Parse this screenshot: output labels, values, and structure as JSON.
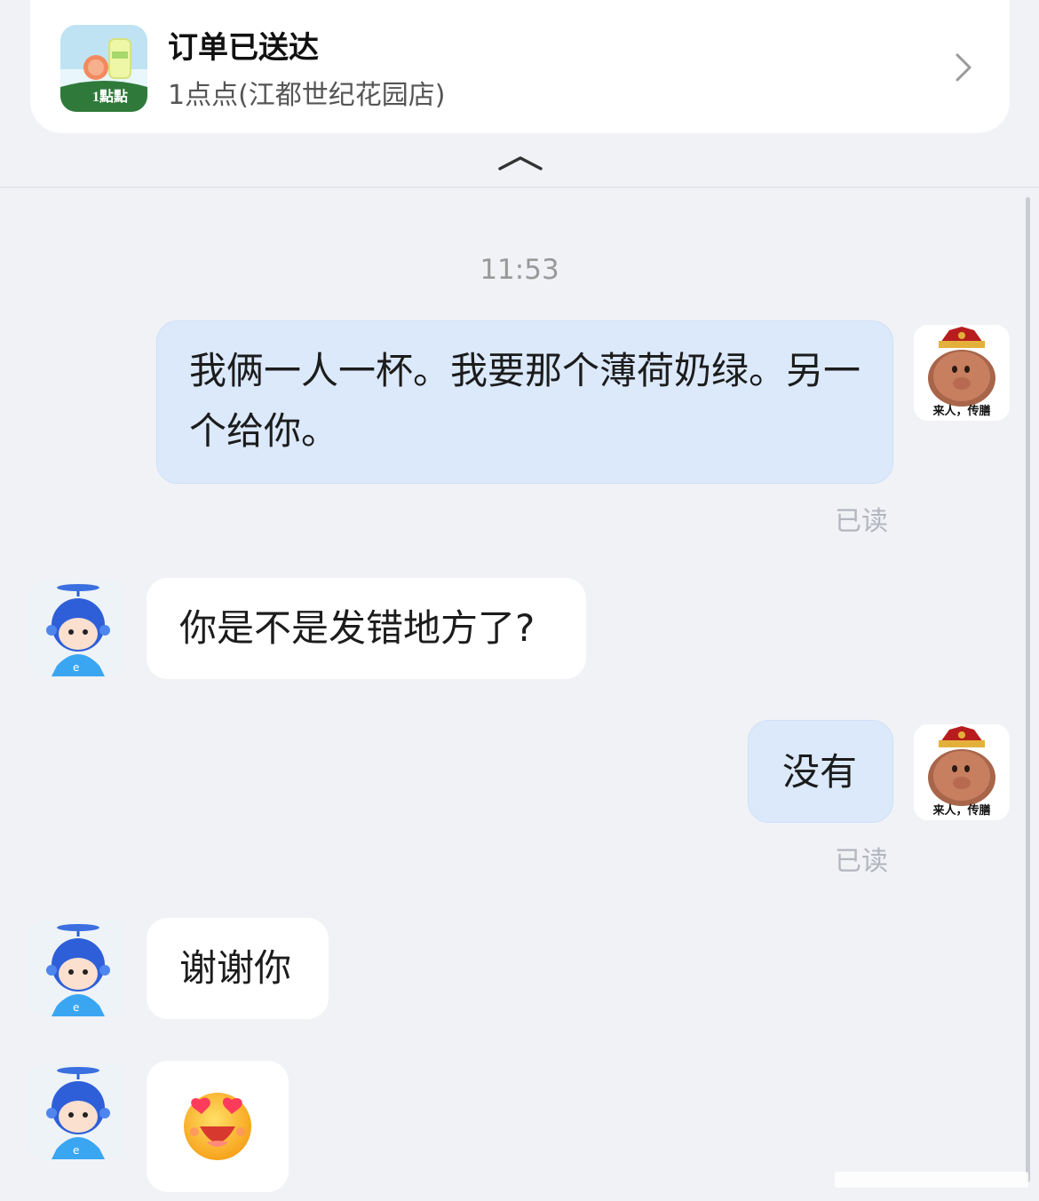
{
  "order": {
    "status": "订单已送达",
    "store": "1点点(江都世纪花园店)",
    "logo_mark": "1點點",
    "chevron_icon": "chevron-right-icon"
  },
  "collapse_icon": "chevron-up-icon",
  "timestamp": "11:53",
  "messages": [
    {
      "side": "me",
      "text": "我俩一人一杯。我要那个薄荷奶绿。另一个给你。",
      "read": "已读"
    },
    {
      "side": "them",
      "text": "你是不是发错地方了?"
    },
    {
      "side": "me",
      "text": "没有",
      "read": "已读"
    },
    {
      "side": "them",
      "text": "谢谢你"
    },
    {
      "side": "them",
      "emoji": "heart-eyes-emoji"
    }
  ],
  "my_avatar_caption": "来人，传膳",
  "colors": {
    "background": "#f0f2f6",
    "my_bubble": "#dbe9fb",
    "their_bubble": "#ffffff",
    "read_text": "#b3b6bd"
  }
}
